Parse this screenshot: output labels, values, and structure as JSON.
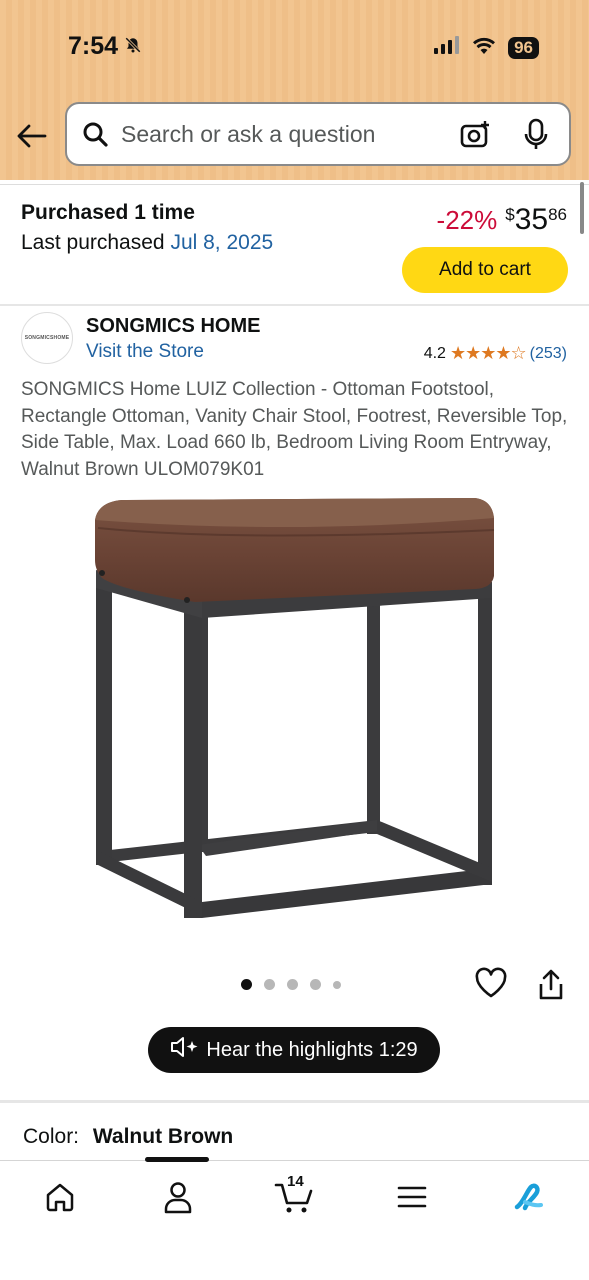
{
  "status_bar": {
    "time": "7:54",
    "battery": "96"
  },
  "search": {
    "placeholder": "Search or ask a question"
  },
  "purchase": {
    "title": "Purchased 1 time",
    "last_label": "Last purchased",
    "last_date": "Jul 8, 2025",
    "discount": "-22%",
    "currency": "$",
    "price_whole": "35",
    "price_fraction": "86",
    "add_to_cart": "Add to cart"
  },
  "store": {
    "logo_text": "SONGMICSHOME",
    "brand": "SONGMICS HOME",
    "visit": "Visit the Store",
    "rating_value": "4.2",
    "stars": "★★★★☆",
    "rating_count": "(253)"
  },
  "product": {
    "title": "SONGMICS Home LUIZ Collection - Ottoman Footstool, Rectangle Ottoman, Vanity Chair Stool, Footrest, Reversible Top, Side Table, Max. Load 660 lb, Bedroom Living Room Entryway, Walnut Brown ULOM079K01"
  },
  "carousel": {
    "total_dots": 5,
    "active_index": 0
  },
  "highlights": {
    "label": "Hear the highlights 1:29"
  },
  "color": {
    "label": "Color:",
    "value": "Walnut Brown"
  },
  "nav": {
    "cart_count": "14"
  },
  "colors": {
    "accent_yellow": "#ffd814",
    "link_blue": "#2162a1",
    "discount_red": "#cc0c39",
    "header_bg": "#f2c590"
  }
}
